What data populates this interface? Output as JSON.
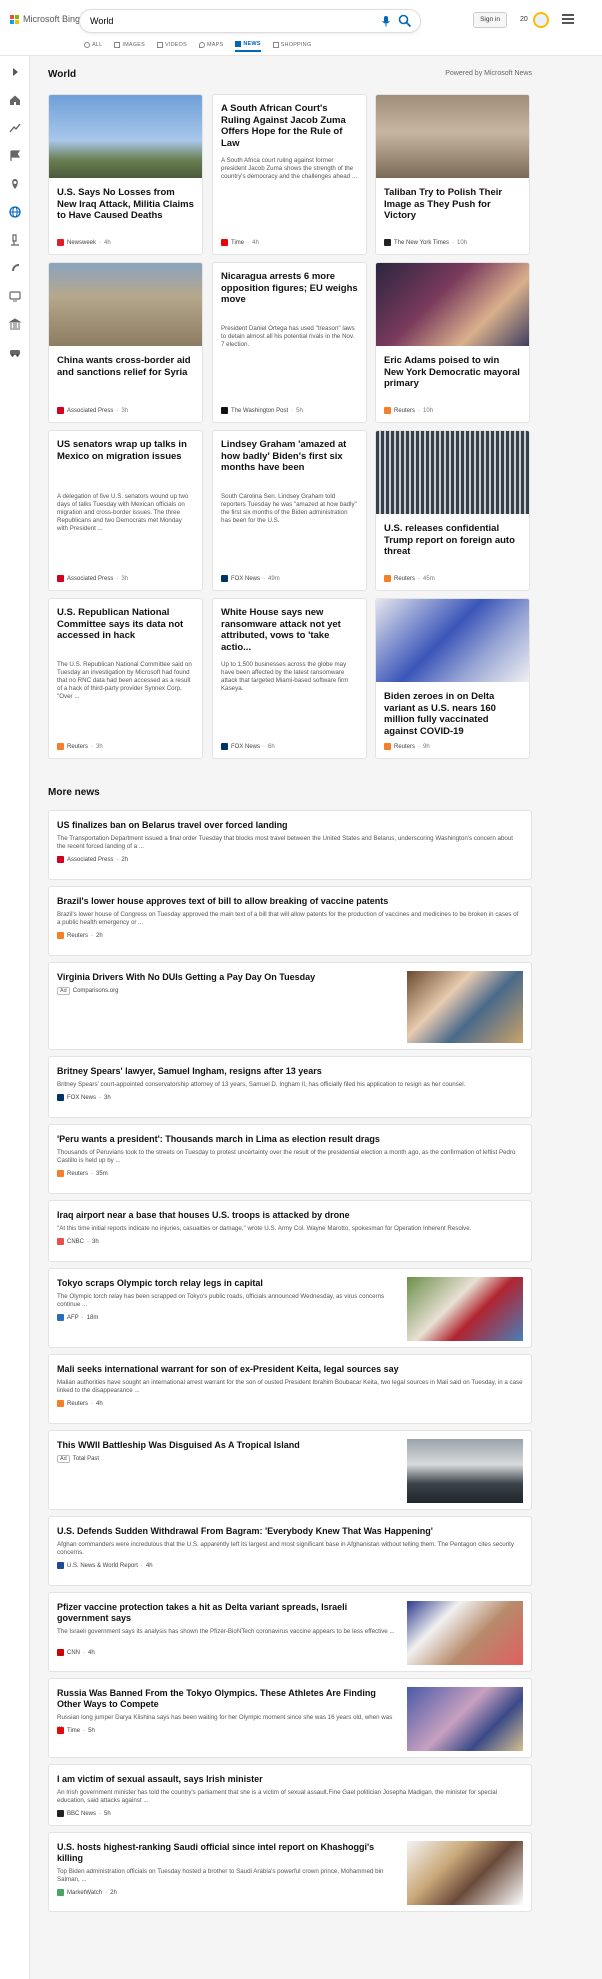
{
  "brand": {
    "logo_text": "Microsoft Bing"
  },
  "search": {
    "query": "World"
  },
  "header": {
    "signin_label": "Sign in",
    "points": "20"
  },
  "tabs": [
    {
      "label": "ALL"
    },
    {
      "label": "IMAGES"
    },
    {
      "label": "VIDEOS"
    },
    {
      "label": "MAPS"
    },
    {
      "label": "NEWS"
    },
    {
      "label": "SHOPPING"
    }
  ],
  "section": {
    "title": "World",
    "powered_by": "Powered by Microsoft News"
  },
  "cards": [
    {
      "title": "U.S. Says No Losses from New Iraq Attack, Militia Claims to Have Caused Deaths",
      "snippet": "",
      "source": "Newsweek",
      "time": "4h",
      "has_image": true
    },
    {
      "title": "A South African Court's Ruling Against Jacob Zuma Offers Hope for the Rule of Law",
      "snippet": "A South Africa court ruling against former president Jacob Zuma shows the strength of the country's democracy and the challenges ahead ...",
      "source": "Time",
      "time": "4h",
      "has_image": false
    },
    {
      "title": "Taliban Try to Polish Their Image as They Push for Victory",
      "snippet": "",
      "source": "The New York Times",
      "time": "10h",
      "has_image": true
    },
    {
      "title": "China wants cross-border aid and sanctions relief for Syria",
      "snippet": "",
      "source": "Associated Press",
      "time": "3h",
      "has_image": true
    },
    {
      "title": "Nicaragua arrests 6 more opposition figures; EU weighs move",
      "snippet": "President Daniel Ortega has used \"treason\" laws to detain almost all his potential rivals in the Nov. 7 election.",
      "source": "The Washington Post",
      "time": "5h",
      "has_image": false
    },
    {
      "title": "Eric Adams poised to win New York Democratic mayoral primary",
      "snippet": "",
      "source": "Reuters",
      "time": "10h",
      "has_image": true
    },
    {
      "title": "US senators wrap up talks in Mexico on migration issues",
      "snippet": "A delegation of five U.S. senators wound up two days of talks Tuesday with Mexican officials on migration and cross-border issues. The three Republicans and two Democrats met Monday with President ...",
      "source": "Associated Press",
      "time": "3h",
      "has_image": false
    },
    {
      "title": "Lindsey Graham 'amazed at how badly' Biden's first six months have been",
      "snippet": "South Carolina Sen. Lindsey Graham told reporters Tuesday he was \"amazed at how badly\" the first six months of the Biden administration has been for the U.S.",
      "source": "FOX News",
      "time": "49m",
      "has_image": false
    },
    {
      "title": "U.S. releases confidential Trump report on foreign auto threat",
      "snippet": "",
      "source": "Reuters",
      "time": "45m",
      "has_image": true
    },
    {
      "title": "U.S. Republican National Committee says its data not accessed in hack",
      "snippet": "The U.S. Republican National Committee said on Tuesday an investigation by Microsoft had found that no RNC data had been accessed as a result of a hack of third-party provider Synnex Corp. \"Over ...",
      "source": "Reuters",
      "time": "3h",
      "has_image": false
    },
    {
      "title": "White House says new ransomware attack not yet attributed, vows to 'take actio...",
      "snippet": "Up to 1,500 businesses across the globe may have been affected by the latest ransomware attack that targeted Miami-based software firm Kaseya.",
      "source": "FOX News",
      "time": "6h",
      "has_image": false
    },
    {
      "title": "Biden zeroes in on Delta variant as U.S. nears 160 million fully vaccinated against COVID-19",
      "snippet": "",
      "source": "Reuters",
      "time": "9h",
      "has_image": true
    }
  ],
  "more_news": {
    "title": "More news"
  },
  "rows": [
    {
      "title": "US finalizes ban on Belarus travel over forced landing",
      "snippet": "The Transportation Department issued a final order Tuesday that blocks most travel between the United States and Belarus, underscoring Washington's concern about the recent forced landing of a ...",
      "source": "Associated Press",
      "time": "2h"
    },
    {
      "title": "Brazil's lower house approves text of bill to allow breaking of vaccine patents",
      "snippet": "Brazil's lower house of Congress on Tuesday approved the main text of a bill that will allow patents for the production of vaccines and medicines to be broken in cases of a public health emergency or ...",
      "source": "Reuters",
      "time": "2h"
    },
    {
      "title": "Virginia Drivers With No DUIs Getting a Pay Day On Tuesday",
      "snippet": "",
      "ad_label": "Ad",
      "source": "Comparisons.org",
      "time": ""
    },
    {
      "title": "Britney Spears' lawyer, Samuel Ingham, resigns after 13 years",
      "snippet": "Britney Spears' court-appointed conservatorship attorney of 13 years, Samuel D. Ingham II, has officially filed his application to resign as her counsel.",
      "source": "FOX News",
      "time": "3h"
    },
    {
      "title": "'Peru wants a president': Thousands march in Lima as election result drags",
      "snippet": "Thousands of Peruvians took to the streets on Tuesday to protest uncertainty over the result of the presidential election a month ago, as the confirmation of leftist Pedro Castillo is held up by ...",
      "source": "Reuters",
      "time": "35m"
    },
    {
      "title": "Iraq airport near a base that houses U.S. troops is attacked by drone",
      "snippet": "\"At this time initial reports indicate no injuries, casualties or damage,\" wrote U.S. Army Col. Wayne Marotto, spokesman for Operation Inherent Resolve.",
      "source": "CNBC",
      "time": "3h"
    },
    {
      "title": "Tokyo scraps Olympic torch relay legs in capital",
      "snippet": "The Olympic torch relay has been scrapped on Tokyo's public roads, officials announced Wednesday, as virus concerns continue ...",
      "source": "AFP",
      "time": "18m"
    },
    {
      "title": "Mali seeks international warrant for son of ex-President Keita, legal sources say",
      "snippet": "Malian authorities have sought an international arrest warrant for the son of ousted President Ibrahim Boubacar Keita, two legal sources in Mali said on Tuesday, in a case linked to the disappearance ...",
      "source": "Reuters",
      "time": "4h"
    },
    {
      "title": "This WWII Battleship Was Disguised As A Tropical Island",
      "snippet": "",
      "ad_label": "Ad",
      "source": "Total Past",
      "time": ""
    },
    {
      "title": "U.S. Defends Sudden Withdrawal From Bagram: 'Everybody Knew That Was Happening'",
      "snippet": "Afghan commanders were incredulous that the U.S. apparently left its largest and most significant base in Afghanistan without telling them. The Pentagon cites security concerns.",
      "source": "U.S. News & World Report",
      "time": "4h"
    },
    {
      "title": "Pfizer vaccine protection takes a hit as Delta variant spreads, Israeli government says",
      "snippet": "The Israeli government says its analysis has shown the Pfizer-BioNTech coronavirus vaccine appears to be less effective ...",
      "source": "CNN",
      "time": "4h"
    },
    {
      "title": "Russia Was Banned From the Tokyo Olympics. These Athletes Are Finding Other Ways to Compete",
      "snippet": "Russian long jumper Darya Klishina says has been waiting for her Olympic moment since she was 16 years old, when was ...",
      "source": "Time",
      "time": "5h"
    },
    {
      "title": "I am victim of sexual assault, says Irish minister",
      "snippet": "An Irish government minister has told the country's parliament that she is a victim of sexual assault.Fine Gael politician Josepha Madigan, the minister for special education, said attacks against ...",
      "source": "BBC News",
      "time": "5h"
    },
    {
      "title": "U.S. hosts highest-ranking Saudi official since intel report on Khashoggi's killing",
      "snippet": "Top Biden administration officials on Tuesday hosted a brother to Saudi Arabia's powerful crown prince, Mohammed bin Salman, ...",
      "source": "MarketWatch",
      "time": "2h"
    }
  ]
}
